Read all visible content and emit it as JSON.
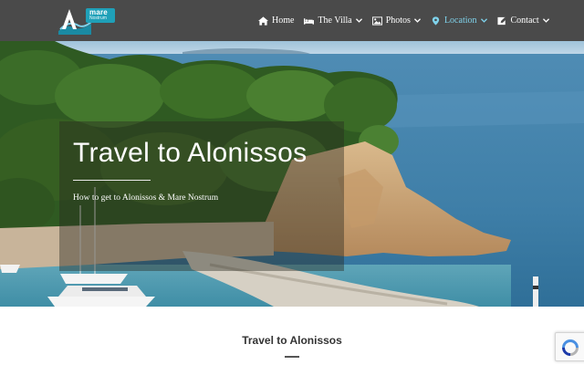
{
  "header": {
    "logo": {
      "word1": "mare",
      "word2": "Nostrum"
    },
    "nav": [
      {
        "label": "Home",
        "icon": "home-icon",
        "dropdown": false,
        "active": false
      },
      {
        "label": "The Villa",
        "icon": "bed-icon",
        "dropdown": true,
        "active": false
      },
      {
        "label": "Photos",
        "icon": "image-icon",
        "dropdown": true,
        "active": false
      },
      {
        "label": "Location",
        "icon": "map-marker-icon",
        "dropdown": true,
        "active": true
      },
      {
        "label": "Contact",
        "icon": "edit-icon",
        "dropdown": true,
        "active": false
      }
    ]
  },
  "hero": {
    "title": "Travel to Alonissos",
    "subtitle": "How to get to Alonissos & Mare Nostrum"
  },
  "content": {
    "section_title": "Travel to Alonissos"
  },
  "colors": {
    "header_bg": "#4a4a4a",
    "accent": "#7fd3ec",
    "logo_teal": "#1fa0b8",
    "sea": "#3f7fa8"
  }
}
